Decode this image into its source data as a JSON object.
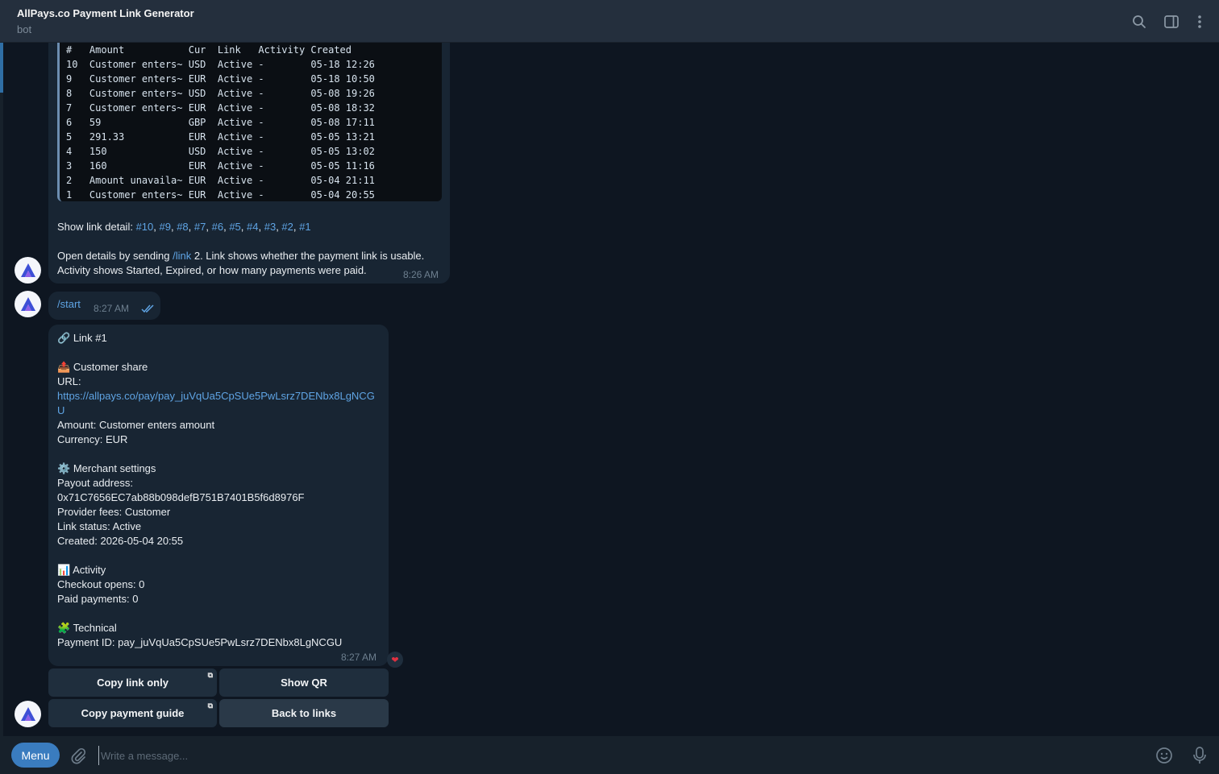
{
  "header": {
    "title": "AllPays.co Payment Link Generator",
    "subtitle": "bot"
  },
  "table": {
    "header": "#   Amount           Cur  Link   Activity Created",
    "rows": [
      "10  Customer enters~ USD  Active -        05-18 12:26",
      "9   Customer enters~ EUR  Active -        05-18 10:50",
      "8   Customer enters~ USD  Active -        05-08 19:26",
      "7   Customer enters~ EUR  Active -        05-08 18:32",
      "6   59               GBP  Active -        05-08 17:11",
      "5   291.33           EUR  Active -        05-05 13:21",
      "4   150              USD  Active -        05-05 13:02",
      "3   160              EUR  Active -        05-05 11:16",
      "2   Amount unavaila~ EUR  Active -        05-04 21:11",
      "1   Customer enters~ EUR  Active -        05-04 20:55"
    ]
  },
  "list_msg": {
    "show_detail_prefix": "Show link detail: ",
    "links": [
      "#10",
      "#9",
      "#8",
      "#7",
      "#6",
      "#5",
      "#4",
      "#3",
      "#2",
      "#1"
    ],
    "open_prefix": "Open details by sending ",
    "open_cmd": "/link",
    "open_suffix": " 2. Link shows whether the payment link is usable.",
    "line2": "Activity shows Started, Expired, or how many payments were paid.",
    "time": "8:26 AM"
  },
  "start_msg": {
    "text": "/start",
    "time": "8:27 AM"
  },
  "detail_msg": {
    "link_title": "Link #1",
    "customer_share": "Customer share",
    "url_label": "URL:",
    "url_line1": "https://allpays.co/pay/pay_juVqUa5CpSUe5PwLsrz7DENbx8LgNCG",
    "url_line2": "U",
    "amount": "Amount: Customer enters amount",
    "currency": "Currency: EUR",
    "merchant_settings": "Merchant settings",
    "payout_label": "Payout address:",
    "payout_address": "0x71C7656EC7ab88b098defB751B7401B5f6d8976F",
    "provider_fees": "Provider fees: Customer",
    "link_status": "Link status: Active",
    "created": "Created: 2026-05-04 20:55",
    "activity": "Activity",
    "checkout_opens": "Checkout opens: 0",
    "paid_payments": "Paid payments: 0",
    "technical": "Technical",
    "payment_id": "Payment ID: pay_juVqUa5CpSUe5PwLsrz7DENbx8LgNCGU",
    "time": "8:27 AM"
  },
  "keyboard": {
    "copy_link": "Copy link only",
    "show_qr": "Show QR",
    "copy_guide": "Copy payment guide",
    "back": "Back to links"
  },
  "composer": {
    "menu_label": "Menu",
    "placeholder": "Write a message..."
  },
  "colors": {
    "accent": "#3a7cbf",
    "link": "#5fa4e4",
    "bubble": "#182533",
    "background": "#0e1621"
  },
  "icons": [
    "search-icon",
    "sidebar-toggle-icon",
    "more-vertical-icon",
    "attach-icon",
    "emoji-icon",
    "mic-icon",
    "link-emoji-icon",
    "outbox-emoji-icon",
    "gear-emoji-icon",
    "chart-emoji-icon",
    "puzzle-emoji-icon",
    "heart-reaction-icon",
    "read-check-icon"
  ]
}
